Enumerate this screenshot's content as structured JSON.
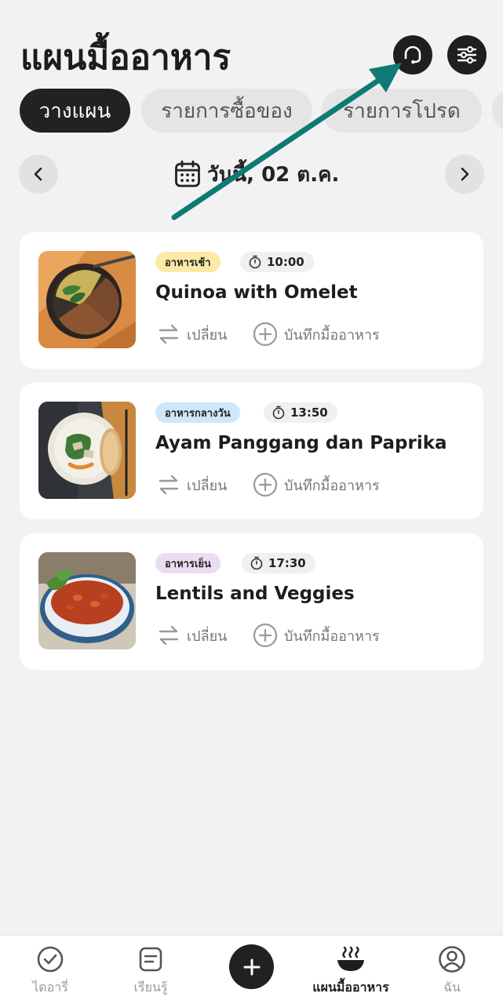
{
  "header": {
    "title": "แผนมื้ออาหาร",
    "support_icon": "headset-icon",
    "filter_icon": "sliders-icon"
  },
  "tabs": [
    {
      "label": "วางแผน",
      "active": true
    },
    {
      "label": "รายการซื้อของ",
      "active": false
    },
    {
      "label": "รายการโปรด",
      "active": false
    }
  ],
  "date": {
    "label": "วันนี้, 02 ต.ค.",
    "prev_icon": "chevron-left-icon",
    "next_icon": "chevron-right-icon",
    "calendar_icon": "calendar-icon"
  },
  "meals": [
    {
      "type_label": "อาหารเช้า",
      "type_color": "#fbe9a6",
      "time": "10:00",
      "name": "Quinoa with Omelet",
      "swap_label": "เปลี่ยน",
      "log_label": "บันทึกมื้ออาหาร"
    },
    {
      "type_label": "อาหารกลางวัน",
      "type_color": "#cfe6fb",
      "time": "13:50",
      "name": "Ayam Panggang dan Paprika",
      "swap_label": "เปลี่ยน",
      "log_label": "บันทึกมื้ออาหาร"
    },
    {
      "type_label": "อาหารเย็น",
      "type_color": "#ecdcf3",
      "time": "17:30",
      "name": "Lentils and Veggies",
      "swap_label": "เปลี่ยน",
      "log_label": "บันทึกมื้ออาหาร"
    }
  ],
  "bottom_nav": [
    {
      "label": "ไดอารี่",
      "icon": "check-circle-icon",
      "active": false
    },
    {
      "label": "เรียนรู้",
      "icon": "document-icon",
      "active": false
    },
    {
      "label": "",
      "icon": "plus-icon",
      "active": false
    },
    {
      "label": "แผนมื้ออาหาร",
      "icon": "steaming-bowl-icon",
      "active": true
    },
    {
      "label": "ฉัน",
      "icon": "profile-icon",
      "active": false
    }
  ],
  "colors": {
    "accent_dark": "#1f1f1f",
    "annotation_arrow": "#0f7a74"
  }
}
